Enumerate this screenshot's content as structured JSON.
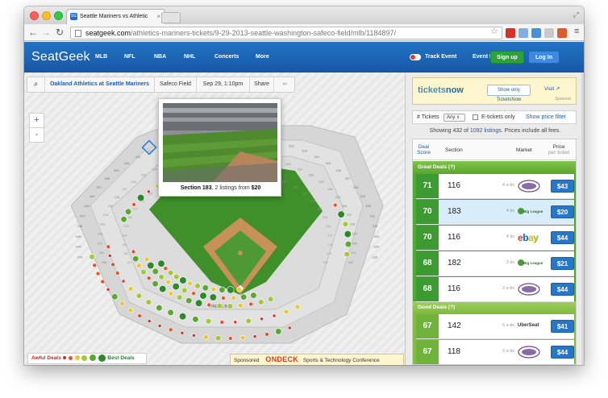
{
  "browser": {
    "tab_title": "Seattle Mariners vs Athletic",
    "tab_favicon": "SG",
    "url_host": "seatgeek.com",
    "url_path": "/athletics-mariners-tickets/9-29-2013-seattle-washington-safeco-field/mlb/1184897/"
  },
  "header": {
    "logo": "SeatGeek",
    "nav": [
      "MLB",
      "NFL",
      "NBA",
      "NHL",
      "Concerts",
      "More"
    ],
    "track_event": "Track Event",
    "event_info": "Event Info",
    "signup": "Sign up",
    "login": "Log In"
  },
  "filterbar": {
    "event": "Oakland Athletics at Seattle Mariners",
    "venue": "Safeco Field",
    "date": "Sep 29, 1:10pm",
    "share": "Share"
  },
  "zoom": {
    "plus": "+",
    "minus": "-"
  },
  "tooltip": {
    "section_label": "Section 183",
    "detail": ", 2 listings from ",
    "price": "$20"
  },
  "legend": {
    "awful": "Awful Deals",
    "best": "Best Deals"
  },
  "ad": {
    "sponsored": "Sponsored",
    "brand": "ONDECK",
    "text": "Sports & Technology Conference"
  },
  "map": {
    "home": "HOME",
    "pressbox": "PRESS BOX",
    "section_numbers": [
      "101",
      "102",
      "103",
      "104",
      "105",
      "106",
      "107",
      "108",
      "109",
      "110",
      "111",
      "112",
      "113",
      "114",
      "115",
      "116",
      "117",
      "118",
      "119",
      "120",
      "121",
      "122",
      "123",
      "124",
      "125",
      "126",
      "127",
      "128",
      "129",
      "130",
      "131",
      "132",
      "133",
      "134",
      "135",
      "136",
      "137",
      "138",
      "139",
      "140",
      "141",
      "142",
      "143",
      "144",
      "145",
      "146",
      "147",
      "148",
      "149",
      "150",
      "151",
      "152",
      "180",
      "181",
      "182",
      "183",
      "184",
      "185",
      "186",
      "187",
      "188",
      "189",
      "190",
      "191",
      "192",
      "193",
      "194",
      "195",
      "211",
      "212",
      "213",
      "214",
      "215",
      "216",
      "217",
      "218",
      "219",
      "220",
      "221",
      "222",
      "223",
      "224",
      "225",
      "226",
      "227",
      "228",
      "229",
      "230",
      "231",
      "232",
      "233",
      "234",
      "235",
      "236",
      "237",
      "238",
      "239",
      "240",
      "241",
      "242",
      "243",
      "244",
      "245",
      "246",
      "247",
      "248",
      "306",
      "307",
      "308",
      "309",
      "310",
      "311",
      "312",
      "313",
      "314",
      "315",
      "316",
      "317",
      "318",
      "319",
      "320",
      "321",
      "322",
      "323",
      "324",
      "325",
      "326",
      "327",
      "328",
      "329",
      "330",
      "331",
      "332",
      "333",
      "334",
      "335",
      "336",
      "337",
      "338",
      "339",
      "340",
      "341",
      "342",
      "343",
      "344",
      "345",
      "346",
      "347",
      "348"
    ]
  },
  "sidebar": {
    "tn_logo_a": "tickets",
    "tn_logo_b": "now",
    "tn_button": "Show only TicketsNow",
    "tn_visit": "Visit",
    "tn_sponsor": "Sponsor",
    "tickets_label": "# Tickets",
    "tickets_value": "Any",
    "etix_label": "E-tickets only",
    "price_filter": "Show price filter",
    "showing_a": "Showing 432 of ",
    "showing_link": "1092 listings",
    "showing_b": ". Prices include all fees.",
    "col_deal_a": "Deal",
    "col_deal_b": "Score",
    "col_section": "Section",
    "col_market": "Market",
    "col_price_a": "Price",
    "col_price_b": "per ticket",
    "great_label": "Great Deals (?)",
    "good_label": "Good Deals (?)"
  },
  "listings": [
    {
      "score": "71",
      "section": "116",
      "etix": "4 e-tix",
      "market": "stubhub",
      "price": "$43"
    },
    {
      "score": "70",
      "section": "183",
      "etix": "4 tix",
      "market": "bigleague",
      "price": "$20"
    },
    {
      "score": "70",
      "section": "116",
      "etix": "4 tix",
      "market": "ebay",
      "price": "$44"
    },
    {
      "score": "68",
      "section": "182",
      "etix": "3 tix",
      "market": "bigleague",
      "price": "$21"
    },
    {
      "score": "68",
      "section": "116",
      "etix": "2 e-tix",
      "market": "stubhub",
      "price": "$44"
    },
    {
      "score": "67",
      "section": "142",
      "etix": "5 e-tix",
      "market": "uberseat",
      "price": "$41"
    },
    {
      "score": "67",
      "section": "118",
      "etix": "2 e-tix",
      "market": "stubhub",
      "price": "$44"
    }
  ],
  "market_labels": {
    "uberseat": "UberSeat",
    "ebay": "ebay",
    "bigleague": "Big League"
  },
  "colors": {
    "header": "#1d66b8",
    "deal_green": "#3b9a30",
    "price_blue": "#2577cc"
  }
}
